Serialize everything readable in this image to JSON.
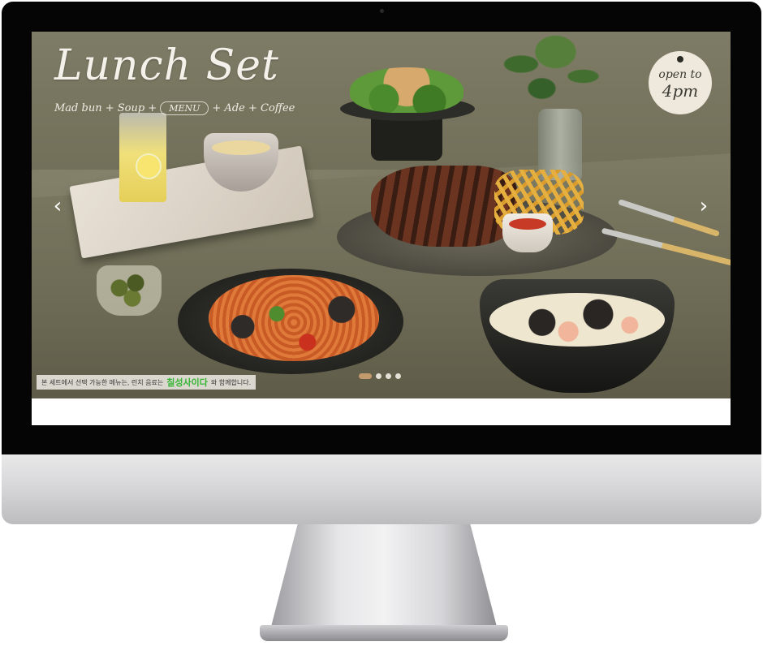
{
  "hero": {
    "title": "Lunch Set",
    "subtitle_before": "Mad bun + Soup +",
    "subtitle_menu": "MENU",
    "subtitle_after": "+ Ade + Coffee",
    "badge_line1": "open to",
    "badge_line2": "4pm",
    "prev_arrow": "‹",
    "next_arrow": "›",
    "notice_text": "본 세트에서 선택 가능한 메뉴는, 런치 음료는",
    "notice_brand": "칠성사이다",
    "notice_suffix": "와 함께합니다.",
    "slide_count": 4,
    "active_slide": 1
  },
  "colors": {
    "bezel": "#050505",
    "accent_dot": "#c39a6c",
    "brand_green": "#35b534"
  }
}
